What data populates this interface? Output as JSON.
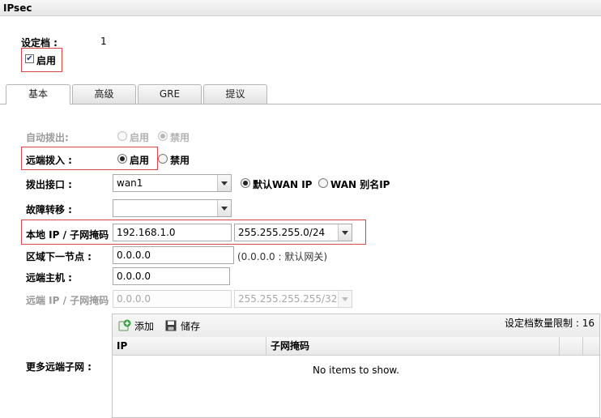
{
  "window": {
    "title": "IPsec"
  },
  "profile": {
    "label": "设定档 :",
    "value": "1"
  },
  "enable": {
    "label": "启用",
    "checked": true
  },
  "tabs": [
    {
      "label": "基本",
      "active": true
    },
    {
      "label": "高级",
      "active": false
    },
    {
      "label": "GRE",
      "active": false
    },
    {
      "label": "提议",
      "active": false
    }
  ],
  "auto_dial_out": {
    "label": "自动拨出:",
    "options": [
      "启用",
      "禁用"
    ],
    "selected": "禁用",
    "disabled": true
  },
  "remote_dial_in": {
    "label": "远端拨入 :",
    "options": [
      "启用",
      "禁用"
    ],
    "selected": "启用"
  },
  "dial_out_interface": {
    "label": "拨出接口 :",
    "value": "wan1",
    "options": [
      "默认WAN IP",
      "WAN 别名IP"
    ],
    "selected": "默认WAN IP"
  },
  "failover": {
    "label": "故障转移 :",
    "value": ""
  },
  "local_ip": {
    "label": "本地 IP / 子网掩码 :",
    "ip": "192.168.1.0",
    "mask": "255.255.255.0/24"
  },
  "next_hop": {
    "label": "区域下一节点 :",
    "value": "0.0.0.0",
    "hint": "(0.0.0.0 : 默认网关)"
  },
  "remote_host": {
    "label": "远端主机 :",
    "value": "0.0.0.0"
  },
  "remote_ip": {
    "label": "远端 IP / 子网掩码 :",
    "ip": "0.0.0.0",
    "mask": "255.255.255.255/32",
    "disabled": true
  },
  "more_subnets": {
    "label": "更多远端子网 :",
    "add_label": "添加",
    "save_label": "储存",
    "limit_text": "设定档数量限制 : 16",
    "columns": [
      "IP",
      "子网掩码"
    ],
    "empty_text": "No items to show."
  },
  "icons": {
    "add": "add-icon",
    "save": "save-disk-icon",
    "check": "checkmark-icon",
    "dropdown": "chevron-down-icon"
  },
  "colors": {
    "highlight_border": "#d9464a",
    "add_icon": "#3aa34a"
  }
}
